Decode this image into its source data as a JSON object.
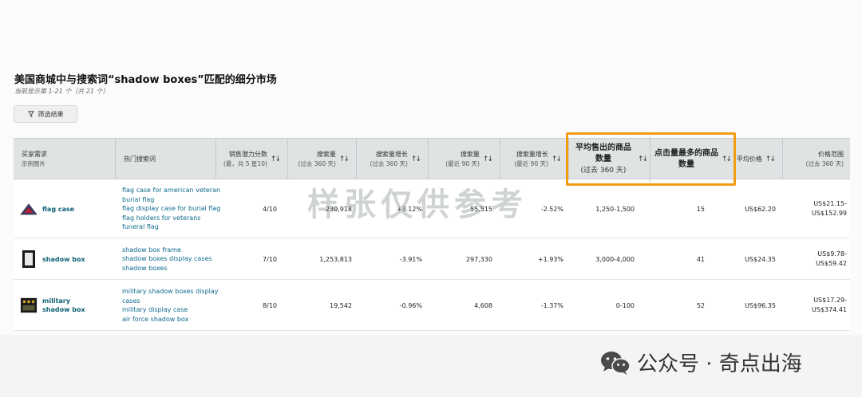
{
  "header": {
    "title": "美国商城中与搜索词“shadow boxes”匹配的细分市场",
    "subtitle": "当前显示第 1-21 个（共 21 个）",
    "filter_label": "筛选结果"
  },
  "columns": [
    {
      "label": "买家需求",
      "sub": "示例图片"
    },
    {
      "label": "热门搜索词",
      "sub": ""
    },
    {
      "label": "销售潜力分数",
      "sub": "(最，共 5 星10)"
    },
    {
      "label": "搜索量",
      "sub": "(过去 360 天)"
    },
    {
      "label": "搜索量增长",
      "sub": "(过去 360 天)"
    },
    {
      "label": "搜索量",
      "sub": "(最近 90 天)"
    },
    {
      "label": "搜索量增长",
      "sub": "(最近 90 天)"
    },
    {
      "label": "平均售出的商品数量",
      "sub": "(过去 360 天)"
    },
    {
      "label": "点击量最多的商品数量",
      "sub": ""
    },
    {
      "label": "平均价格",
      "sub": ""
    },
    {
      "label": "价格范围",
      "sub": "(过去 360 天)"
    }
  ],
  "rows": [
    {
      "name": "flag case",
      "keywords": [
        "flag case for american veteran",
        "burial flag",
        "flag display case for burial flag",
        "flag holders for veterans",
        "funeral flag"
      ],
      "score": "4/10",
      "vol360": "230,918",
      "growth360": "+3.12%",
      "vol90": "55,515",
      "growth90": "-2.52%",
      "units": "1,250-1,500",
      "clicked": "15",
      "avg_price": "US$62.20",
      "price_low": "US$21.15-",
      "price_high": "US$152.99"
    },
    {
      "name": "shadow box",
      "keywords": [
        "shadow box frame",
        "shadow boxes display cases",
        "shadow boxes"
      ],
      "score": "7/10",
      "vol360": "1,253,813",
      "growth360": "-3.91%",
      "vol90": "297,330",
      "growth90": "+1.93%",
      "units": "3,000-4,000",
      "clicked": "41",
      "avg_price": "US$24.35",
      "price_low": "US$9.78-",
      "price_high": "US$59.42"
    },
    {
      "name": "military shadow box",
      "keywords": [
        "military shadow boxes display",
        "cases",
        "military display case",
        "air force shadow box"
      ],
      "score": "8/10",
      "vol360": "19,542",
      "growth360": "-0.96%",
      "vol90": "4,608",
      "growth90": "-1.37%",
      "units": "0-100",
      "clicked": "52",
      "avg_price": "US$96.35",
      "price_low": "US$17.29-",
      "price_high": "US$374.41"
    }
  ],
  "watermark": "样张仅供参考",
  "footer": {
    "account": "公众号 · 奇点出海"
  },
  "colors": {
    "highlight": "#f39c12",
    "link": "#0e6a8c"
  }
}
